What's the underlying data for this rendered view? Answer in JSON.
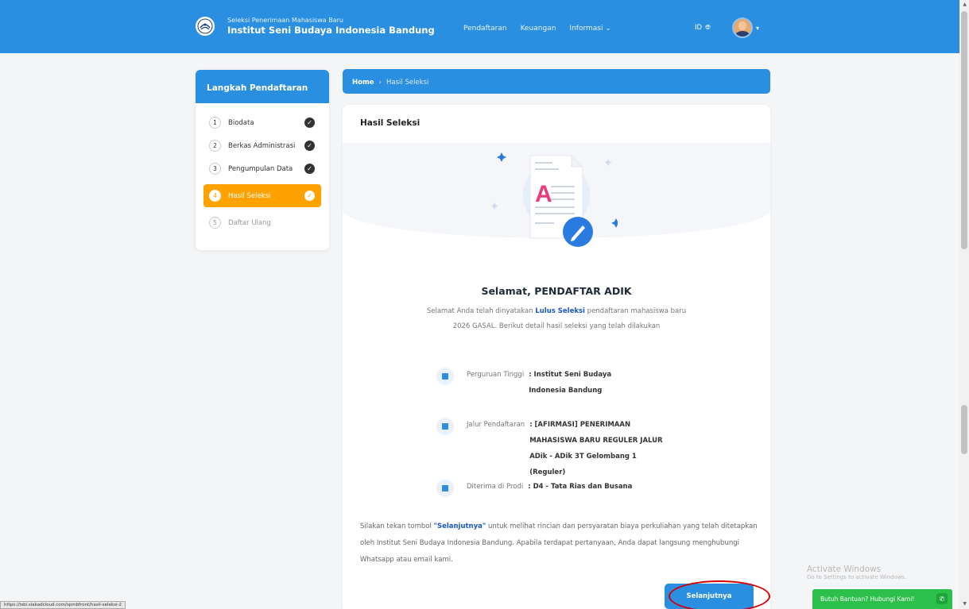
{
  "header": {
    "subtitle": "Seleksi Penerimaan Mahasiswa Baru",
    "title": "Institut Seni Budaya Indonesia Bandung",
    "nav": [
      "Pendaftaran",
      "Keuangan",
      "Informasi"
    ],
    "lang": "ID"
  },
  "sidebar": {
    "title": "Langkah Pendaftaran",
    "steps": [
      {
        "num": "1",
        "label": "Biodata"
      },
      {
        "num": "2",
        "label": "Berkas Administrasi"
      },
      {
        "num": "3",
        "label": "Pengumpulan Data"
      },
      {
        "num": "4",
        "label": "Hasil Seleksi"
      },
      {
        "num": "5",
        "label": "Daftar Ulang"
      }
    ]
  },
  "breadcrumb": {
    "home": "Home",
    "separator": "›",
    "current": "Hasil Seleksi"
  },
  "main": {
    "title": "Hasil Seleksi",
    "headline": "Selamat, PENDAFTAR ADIK",
    "desc_pre": "Selamat Anda telah dinyatakan ",
    "desc_bold": "Lulus Seleksi",
    "desc_post": " pendaftaran mahasiswa baru 2026 GASAL. Berikut detail hasil seleksi yang telah dilakukan",
    "details": [
      {
        "label": "Perguruan Tinggi",
        "value": ": Institut Seni Budaya Indonesia Bandung"
      },
      {
        "label": "Jalur Pendaftaran",
        "value": ": [AFIRMASI] PENERIMAAN MAHASISWA BARU REGULER JALUR ADik - ADik 3T Gelombang 1 (Reguler)"
      },
      {
        "label": "Diterima di Prodi",
        "value": ": D4 - Tata Rias dan Busana"
      }
    ],
    "closing_pre": "Silakan tekan tombol ",
    "closing_bold": "\"Selanjutnya\"",
    "closing_post": " untuk melihat rincian dan persyaratan biaya perkuliahan yang telah ditetapkan oleh Institut Seni Budaya Indonesia Bandung. Apabila terdapat pertanyaan, Anda dapat langsung menghubungi Whatsapp atau email kami.",
    "next_button": "Selanjutnya"
  },
  "status_url": "https://isbi.siakadcloud.com/spmbfront/hasil-seleksi-2",
  "windows": {
    "activate_title": "Activate Windows",
    "activate_sub": "Go to Settings to activate Windows."
  },
  "help_button": "Butuh Bantuan? Hubungi Kami!",
  "colors": {
    "primary": "#2a8fe0",
    "active_step": "#ffa200",
    "link": "#1a57c7",
    "whatsapp": "#2cbf4a"
  }
}
